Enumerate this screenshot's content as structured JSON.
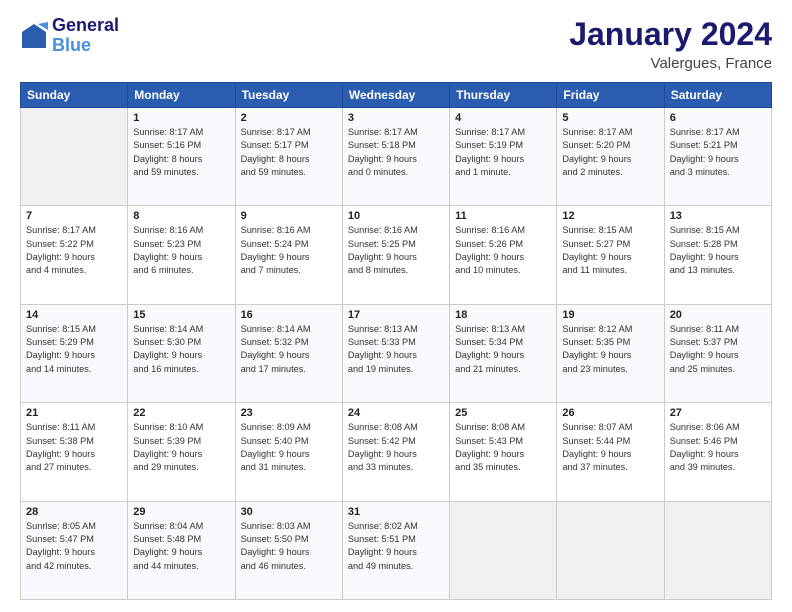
{
  "logo": {
    "line1": "General",
    "line2": "Blue"
  },
  "title": "January 2024",
  "subtitle": "Valergues, France",
  "days_header": [
    "Sunday",
    "Monday",
    "Tuesday",
    "Wednesday",
    "Thursday",
    "Friday",
    "Saturday"
  ],
  "weeks": [
    [
      {
        "num": "",
        "info": ""
      },
      {
        "num": "1",
        "info": "Sunrise: 8:17 AM\nSunset: 5:16 PM\nDaylight: 8 hours\nand 59 minutes."
      },
      {
        "num": "2",
        "info": "Sunrise: 8:17 AM\nSunset: 5:17 PM\nDaylight: 8 hours\nand 59 minutes."
      },
      {
        "num": "3",
        "info": "Sunrise: 8:17 AM\nSunset: 5:18 PM\nDaylight: 9 hours\nand 0 minutes."
      },
      {
        "num": "4",
        "info": "Sunrise: 8:17 AM\nSunset: 5:19 PM\nDaylight: 9 hours\nand 1 minute."
      },
      {
        "num": "5",
        "info": "Sunrise: 8:17 AM\nSunset: 5:20 PM\nDaylight: 9 hours\nand 2 minutes."
      },
      {
        "num": "6",
        "info": "Sunrise: 8:17 AM\nSunset: 5:21 PM\nDaylight: 9 hours\nand 3 minutes."
      }
    ],
    [
      {
        "num": "7",
        "info": "Sunrise: 8:17 AM\nSunset: 5:22 PM\nDaylight: 9 hours\nand 4 minutes."
      },
      {
        "num": "8",
        "info": "Sunrise: 8:16 AM\nSunset: 5:23 PM\nDaylight: 9 hours\nand 6 minutes."
      },
      {
        "num": "9",
        "info": "Sunrise: 8:16 AM\nSunset: 5:24 PM\nDaylight: 9 hours\nand 7 minutes."
      },
      {
        "num": "10",
        "info": "Sunrise: 8:16 AM\nSunset: 5:25 PM\nDaylight: 9 hours\nand 8 minutes."
      },
      {
        "num": "11",
        "info": "Sunrise: 8:16 AM\nSunset: 5:26 PM\nDaylight: 9 hours\nand 10 minutes."
      },
      {
        "num": "12",
        "info": "Sunrise: 8:15 AM\nSunset: 5:27 PM\nDaylight: 9 hours\nand 11 minutes."
      },
      {
        "num": "13",
        "info": "Sunrise: 8:15 AM\nSunset: 5:28 PM\nDaylight: 9 hours\nand 13 minutes."
      }
    ],
    [
      {
        "num": "14",
        "info": "Sunrise: 8:15 AM\nSunset: 5:29 PM\nDaylight: 9 hours\nand 14 minutes."
      },
      {
        "num": "15",
        "info": "Sunrise: 8:14 AM\nSunset: 5:30 PM\nDaylight: 9 hours\nand 16 minutes."
      },
      {
        "num": "16",
        "info": "Sunrise: 8:14 AM\nSunset: 5:32 PM\nDaylight: 9 hours\nand 17 minutes."
      },
      {
        "num": "17",
        "info": "Sunrise: 8:13 AM\nSunset: 5:33 PM\nDaylight: 9 hours\nand 19 minutes."
      },
      {
        "num": "18",
        "info": "Sunrise: 8:13 AM\nSunset: 5:34 PM\nDaylight: 9 hours\nand 21 minutes."
      },
      {
        "num": "19",
        "info": "Sunrise: 8:12 AM\nSunset: 5:35 PM\nDaylight: 9 hours\nand 23 minutes."
      },
      {
        "num": "20",
        "info": "Sunrise: 8:11 AM\nSunset: 5:37 PM\nDaylight: 9 hours\nand 25 minutes."
      }
    ],
    [
      {
        "num": "21",
        "info": "Sunrise: 8:11 AM\nSunset: 5:38 PM\nDaylight: 9 hours\nand 27 minutes."
      },
      {
        "num": "22",
        "info": "Sunrise: 8:10 AM\nSunset: 5:39 PM\nDaylight: 9 hours\nand 29 minutes."
      },
      {
        "num": "23",
        "info": "Sunrise: 8:09 AM\nSunset: 5:40 PM\nDaylight: 9 hours\nand 31 minutes."
      },
      {
        "num": "24",
        "info": "Sunrise: 8:08 AM\nSunset: 5:42 PM\nDaylight: 9 hours\nand 33 minutes."
      },
      {
        "num": "25",
        "info": "Sunrise: 8:08 AM\nSunset: 5:43 PM\nDaylight: 9 hours\nand 35 minutes."
      },
      {
        "num": "26",
        "info": "Sunrise: 8:07 AM\nSunset: 5:44 PM\nDaylight: 9 hours\nand 37 minutes."
      },
      {
        "num": "27",
        "info": "Sunrise: 8:06 AM\nSunset: 5:46 PM\nDaylight: 9 hours\nand 39 minutes."
      }
    ],
    [
      {
        "num": "28",
        "info": "Sunrise: 8:05 AM\nSunset: 5:47 PM\nDaylight: 9 hours\nand 42 minutes."
      },
      {
        "num": "29",
        "info": "Sunrise: 8:04 AM\nSunset: 5:48 PM\nDaylight: 9 hours\nand 44 minutes."
      },
      {
        "num": "30",
        "info": "Sunrise: 8:03 AM\nSunset: 5:50 PM\nDaylight: 9 hours\nand 46 minutes."
      },
      {
        "num": "31",
        "info": "Sunrise: 8:02 AM\nSunset: 5:51 PM\nDaylight: 9 hours\nand 49 minutes."
      },
      {
        "num": "",
        "info": ""
      },
      {
        "num": "",
        "info": ""
      },
      {
        "num": "",
        "info": ""
      }
    ]
  ]
}
